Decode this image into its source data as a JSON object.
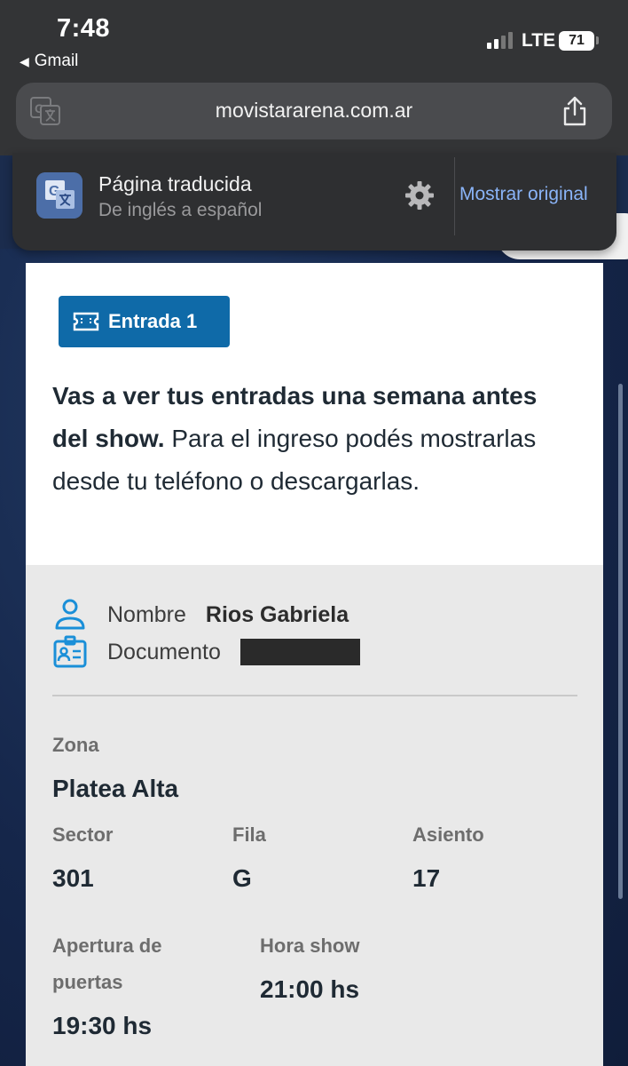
{
  "status_bar": {
    "time": "7:48",
    "back_app": "Gmail",
    "network": "LTE",
    "battery": "71"
  },
  "browser": {
    "url": "movistararena.com.ar"
  },
  "translate_banner": {
    "title": "Página traducida",
    "subtitle": "De inglés a español",
    "show_original": "Mostrar original"
  },
  "ticket": {
    "badge_label": "Entrada 1",
    "info_bold": "Vas a ver tus entradas una semana antes del show.",
    "info_rest": " Para el ingreso podés mostrarlas desde tu teléfono o descargarlas.",
    "holder": {
      "name_label": "Nombre",
      "name_value": "Rios Gabriela",
      "doc_label": "Documento"
    },
    "zona_label": "Zona",
    "zona_value": "Platea Alta",
    "sector_label": "Sector",
    "sector_value": "301",
    "fila_label": "Fila",
    "fila_value": "G",
    "asiento_label": "Asiento",
    "asiento_value": "17",
    "apertura_label_1": "Apertura de",
    "apertura_label_2": "puertas",
    "apertura_value": "19:30 hs",
    "hora_label": "Hora show",
    "hora_value": "21:00 hs"
  },
  "colors": {
    "accent": "#0f6aa8",
    "link": "#8ab4f8",
    "icon_blue": "#1a8fd8"
  },
  "icons": [
    "translate-icon",
    "share-icon",
    "gear-icon",
    "ticket-icon",
    "person-icon",
    "id-card-icon"
  ]
}
